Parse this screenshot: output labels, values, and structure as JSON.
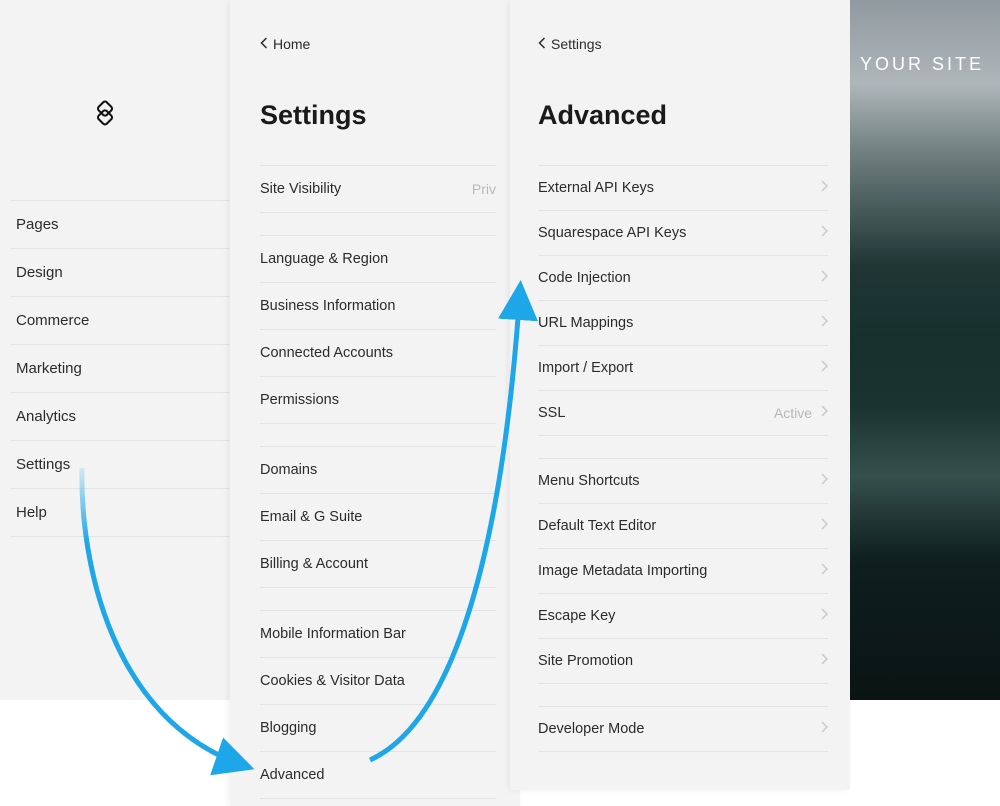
{
  "panel1": {
    "items": [
      "Pages",
      "Design",
      "Commerce",
      "Marketing",
      "Analytics",
      "Settings",
      "Help"
    ]
  },
  "panel2": {
    "back": "Home",
    "title": "Settings",
    "groups": [
      [
        {
          "label": "Site Visibility",
          "value": "Priv"
        }
      ],
      [
        {
          "label": "Language & Region"
        },
        {
          "label": "Business Information"
        },
        {
          "label": "Connected Accounts"
        },
        {
          "label": "Permissions"
        }
      ],
      [
        {
          "label": "Domains"
        },
        {
          "label": "Email & G Suite"
        },
        {
          "label": "Billing & Account"
        }
      ],
      [
        {
          "label": "Mobile Information Bar"
        },
        {
          "label": "Cookies & Visitor Data"
        },
        {
          "label": "Blogging"
        },
        {
          "label": "Advanced"
        }
      ]
    ]
  },
  "panel3": {
    "back": "Settings",
    "title": "Advanced",
    "groups": [
      [
        {
          "label": "External API Keys"
        },
        {
          "label": "Squarespace API Keys"
        },
        {
          "label": "Code Injection"
        },
        {
          "label": "URL Mappings"
        },
        {
          "label": "Import / Export"
        },
        {
          "label": "SSL",
          "value": "Active"
        }
      ],
      [
        {
          "label": "Menu Shortcuts"
        },
        {
          "label": "Default Text Editor"
        },
        {
          "label": "Image Metadata Importing"
        },
        {
          "label": "Escape Key"
        },
        {
          "label": "Site Promotion"
        }
      ],
      [
        {
          "label": "Developer Mode"
        }
      ]
    ]
  },
  "preview": {
    "title": "YOUR SITE"
  }
}
